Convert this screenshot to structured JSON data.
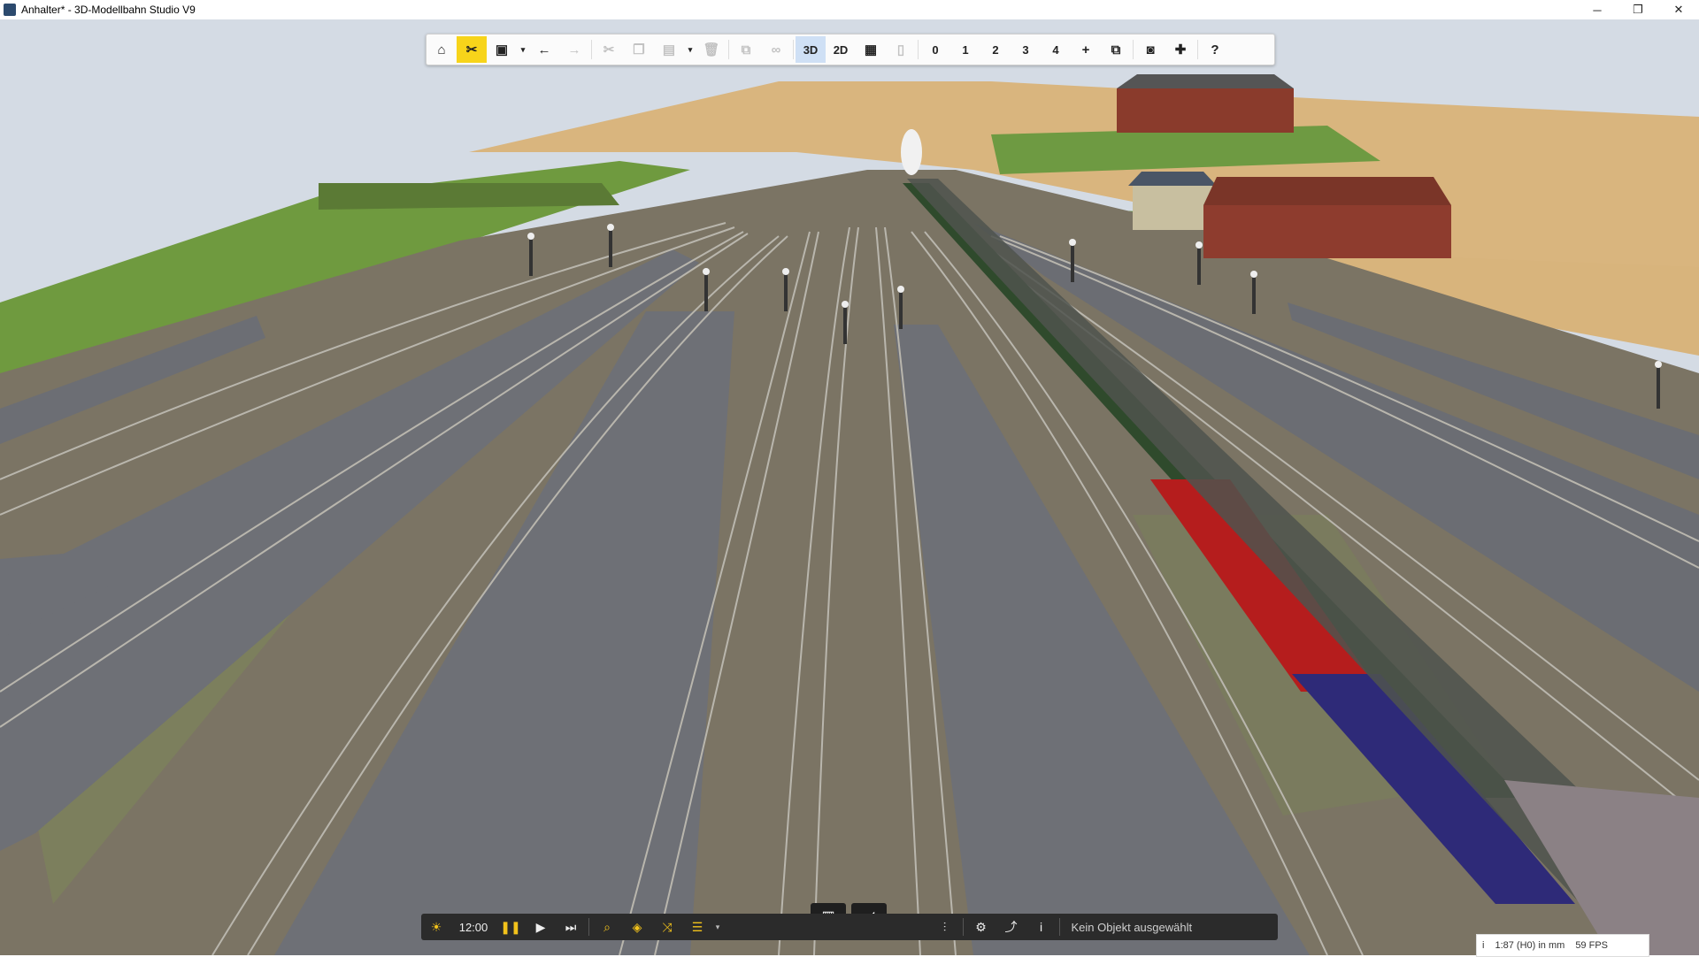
{
  "window": {
    "title": "Anhalter* - 3D-Modellbahn Studio V9",
    "minimize": "─",
    "maximize": "❐",
    "close": "✕"
  },
  "toolbar": {
    "icons": [
      "home-icon",
      "tools-icon",
      "save-icon",
      "undo-icon",
      "redo-icon",
      "cut-icon",
      "copy-icon",
      "paste-icon",
      "delete-icon",
      "group-icon",
      "link-icon",
      "grid-icon",
      "layer-icon",
      "add-icon",
      "window-icon",
      "camera-icon",
      "plugin-icon",
      "help-icon"
    ],
    "view_3d": "3D",
    "view_2d": "2D",
    "layers": [
      "0",
      "1",
      "2",
      "3",
      "4"
    ],
    "help": "?"
  },
  "bottombar": {
    "time": "12:00",
    "status": "Kein Objekt ausgewählt"
  },
  "statusbar": {
    "info": "i",
    "scale": "1:87 (H0) in mm",
    "fps": "59 FPS"
  },
  "colors": {
    "accent_yellow": "#f7d41a",
    "sky": "#d6dde6",
    "ground": "#7a7463",
    "platform": "#6e7076"
  }
}
